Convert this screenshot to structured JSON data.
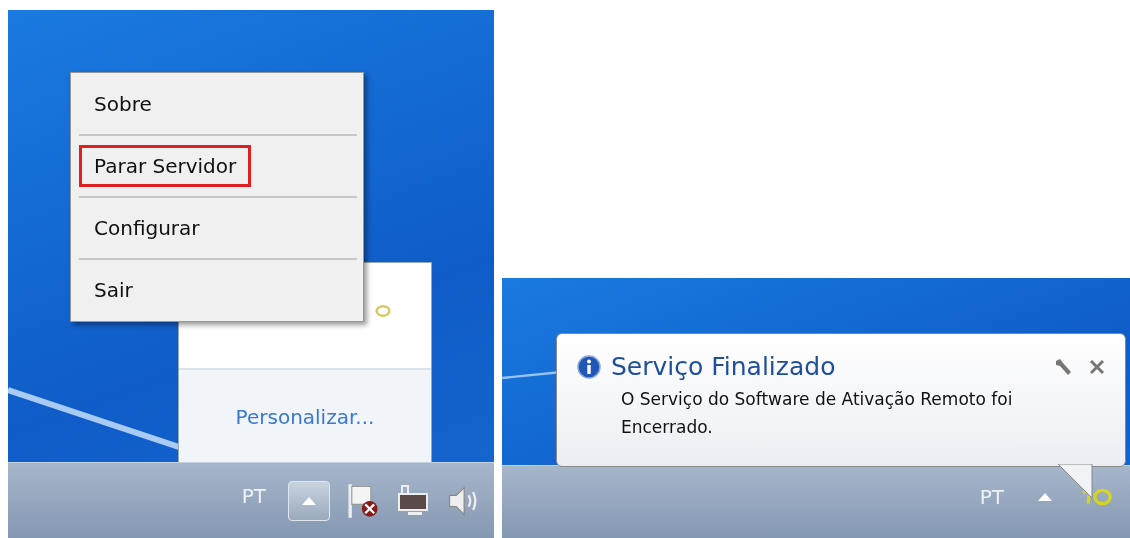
{
  "left_screen": {
    "context_menu": [
      {
        "label": "Sobre",
        "highlighted": false
      },
      {
        "label": "Parar Servidor",
        "highlighted": true
      },
      {
        "label": "Configurar",
        "highlighted": false
      },
      {
        "label": "Sair",
        "highlighted": false
      }
    ],
    "tray_overflow": {
      "link": "Personalizar..."
    },
    "taskbar": {
      "language": "PT"
    }
  },
  "right_screen": {
    "notification": {
      "title": "Serviço Finalizado",
      "message": "O Serviço do Software de Ativação Remoto foi Encerrado."
    },
    "taskbar": {
      "language": "PT"
    }
  }
}
